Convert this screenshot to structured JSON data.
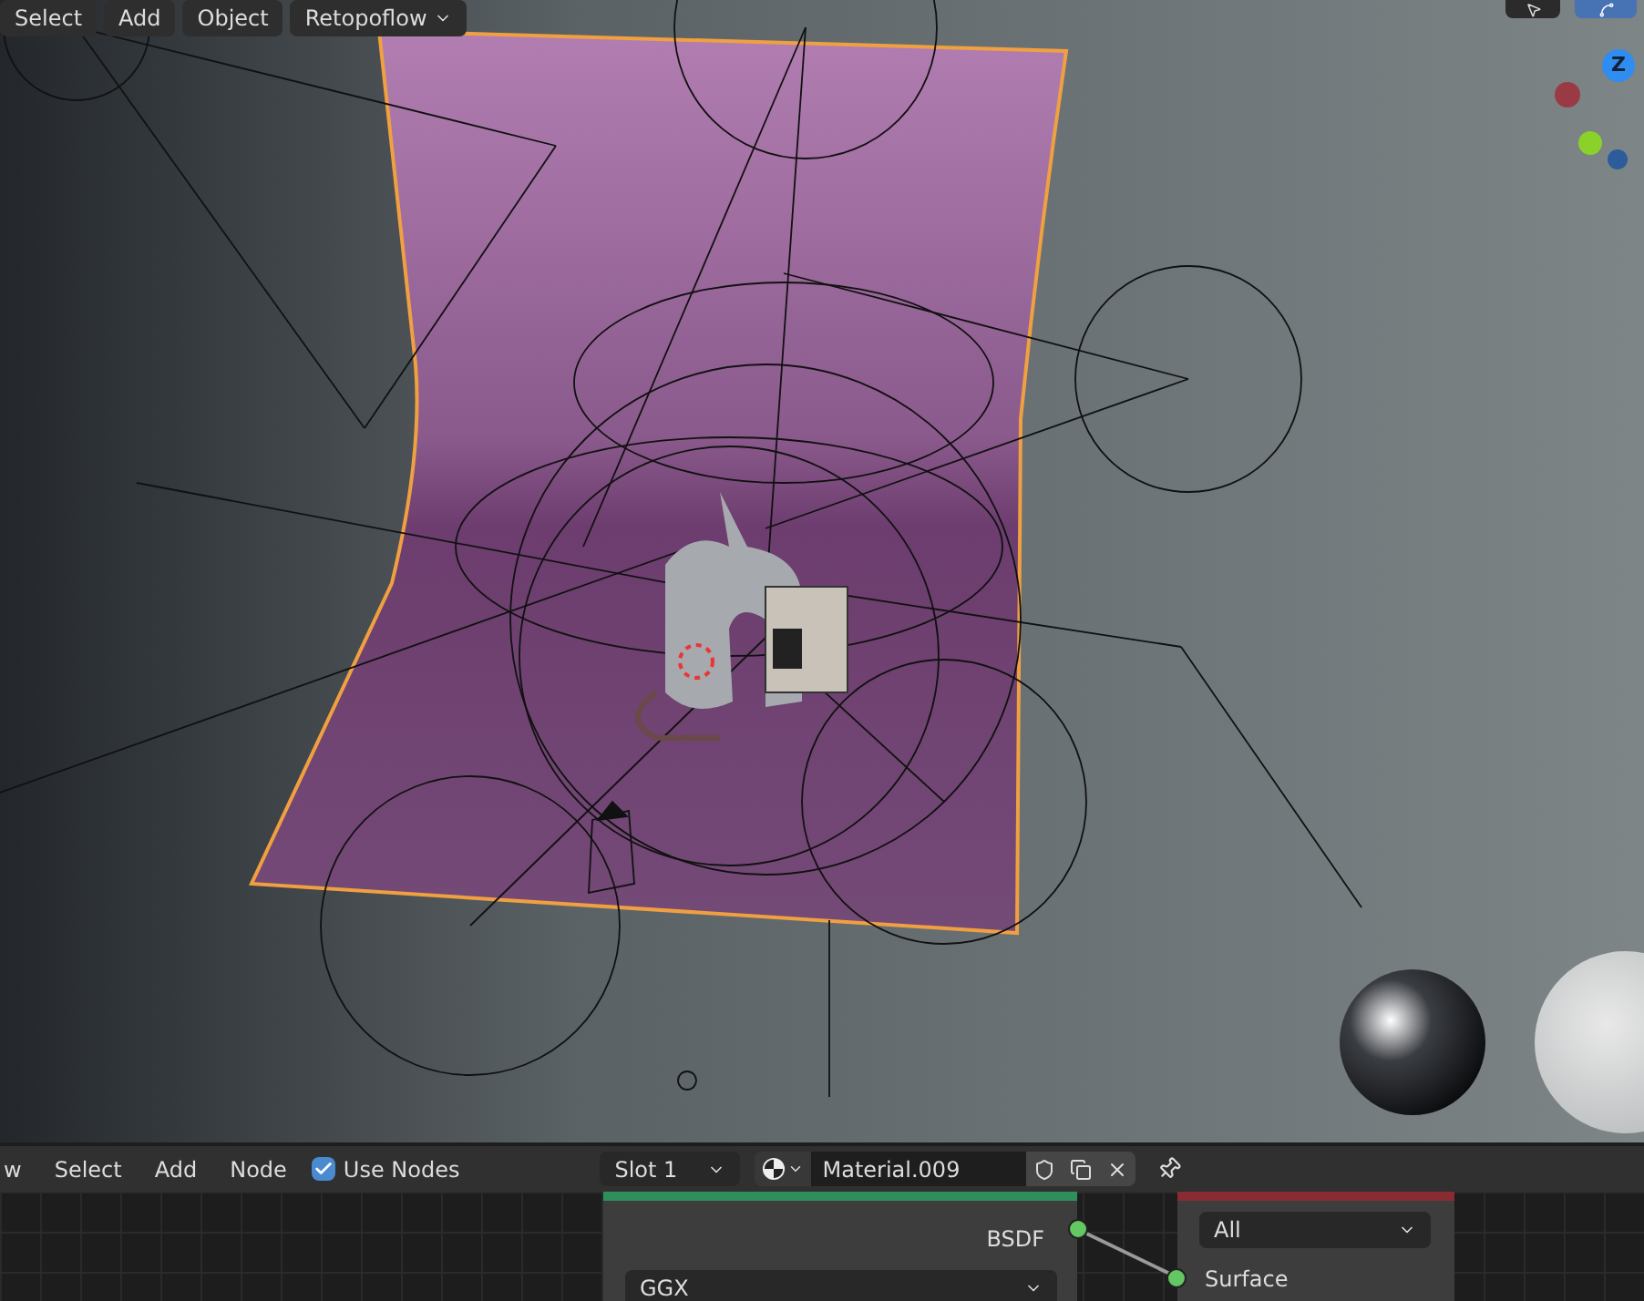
{
  "viewport": {
    "menu": [
      "Select",
      "Add",
      "Object"
    ],
    "mode_dropdown": "Retopoflow",
    "gizmo": {
      "z_label": "Z"
    }
  },
  "node_editor": {
    "header": {
      "menu": [
        "w",
        "Select",
        "Add",
        "Node"
      ],
      "use_nodes": {
        "label": "Use Nodes",
        "checked": true
      },
      "slot": "Slot 1",
      "material": "Material.009"
    },
    "nodes": [
      {
        "kind": "shader",
        "color": "#2f8f5b",
        "output": "BSDF",
        "dropdown": "GGX"
      },
      {
        "kind": "output",
        "color": "#8a2a33",
        "dropdown": "All",
        "input": "Surface"
      }
    ]
  }
}
